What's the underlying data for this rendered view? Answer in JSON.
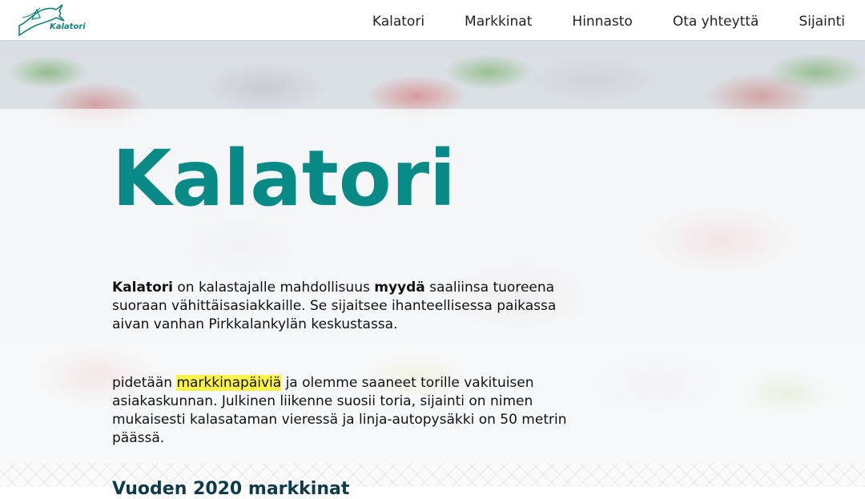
{
  "header": {
    "logo_text": "Kalatori",
    "nav": [
      "Kalatori",
      "Markkinat",
      "Hinnasto",
      "Ota yhteyttä",
      "Sijainti"
    ]
  },
  "hero": {
    "title": "Kalatori",
    "para1": {
      "bold1": "Kalatori",
      "text1": " on kalastajalle mahdollisuus ",
      "bold2": "myydä",
      "text2": " saaliinsa tuoreena suoraan vähittäisasiakkaille. Se sijaitsee ihanteellisessa paikassa aivan vanhan Pirkkalankylän keskustassa."
    },
    "para2": {
      "text1": "pidetään ",
      "highlight": "markkinapäiviä",
      "text2": " ja olemme saaneet torille vakituisen asiakaskunnan. Julkinen liikenne suosii toria, sijainti on nimen mukaisesti kalasataman vieressä ja linja-autopysäkki on 50 metrin päässä."
    }
  },
  "bottom": {
    "heading": "Vuoden 2020 markkinat"
  },
  "colors": {
    "brand": "#0a8a86",
    "highlight": "#fff34d",
    "heading_dark": "#0d3b4a"
  }
}
